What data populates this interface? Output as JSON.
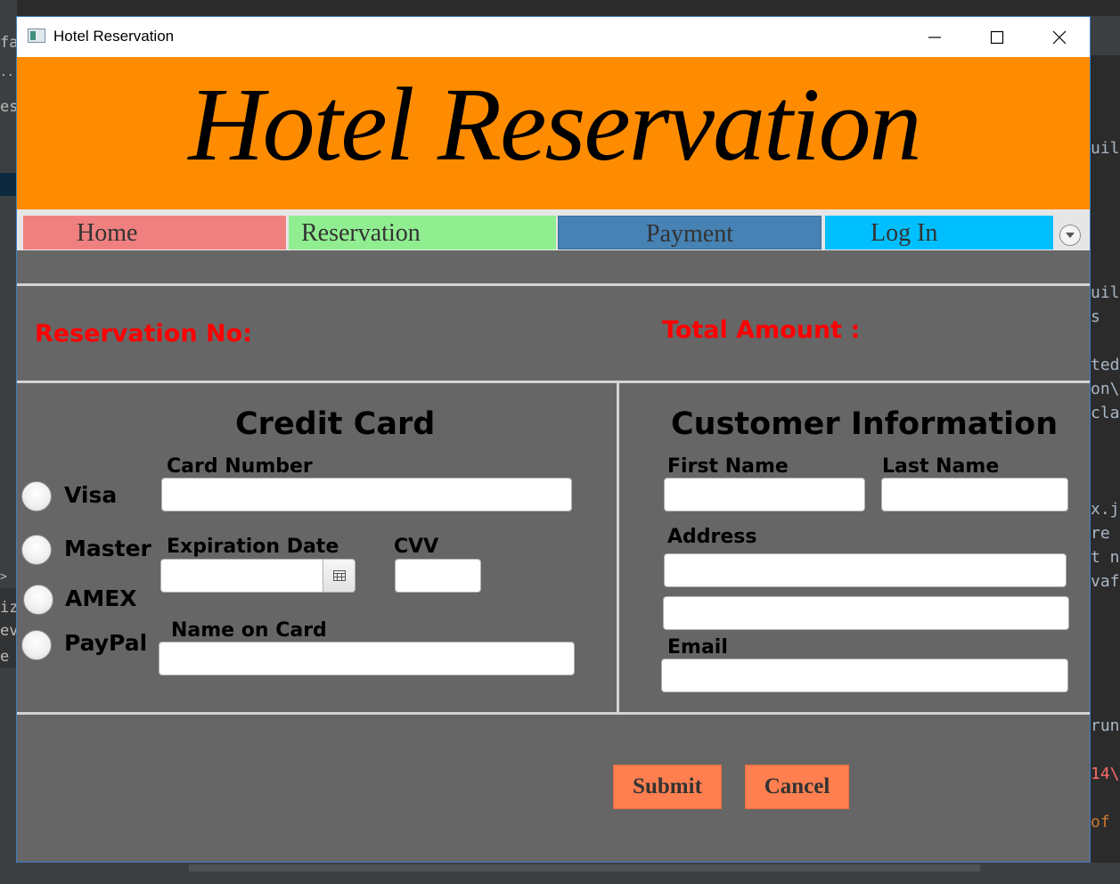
{
  "window": {
    "title": "Hotel Reservation"
  },
  "banner": {
    "title": "Hotel Reservation"
  },
  "tabs": [
    {
      "label": "Home",
      "color": "#f08080"
    },
    {
      "label": "Reservation",
      "color": "#90ee90"
    },
    {
      "label": "Payment",
      "color": "#4682b4"
    },
    {
      "label": "Log In",
      "color": "#00bfff"
    }
  ],
  "summary": {
    "reservation_no_label": "Reservation No:",
    "total_amount_label": "Total Amount :"
  },
  "credit_card": {
    "title": "Credit Card",
    "card_types": [
      "Visa",
      "Master",
      "AMEX",
      "PayPal"
    ],
    "card_number_label": "Card Number",
    "expiration_label": "Expiration Date",
    "cvv_label": "CVV",
    "name_on_card_label": "Name on Card"
  },
  "customer": {
    "title": "Customer Information",
    "first_name_label": "First Name",
    "last_name_label": "Last Name",
    "address_label": "Address",
    "email_label": "Email"
  },
  "actions": {
    "submit_label": "Submit",
    "cancel_label": "Cancel"
  },
  "colors": {
    "banner": "#ff8c00",
    "accent_red": "#ff0000",
    "button": "#ff7f50",
    "panel": "#666666"
  },
  "background_ide": {
    "left_fragments": [
      "fa",
      "...",
      "es",
      ">",
      "iza",
      "ev",
      "e n"
    ],
    "right_fragments": [
      "uil",
      "uil",
      "s",
      "ted",
      "on\\",
      "cla",
      "x.j",
      "re",
      "t n",
      "vaf",
      "run",
      "14\\",
      "of"
    ]
  }
}
